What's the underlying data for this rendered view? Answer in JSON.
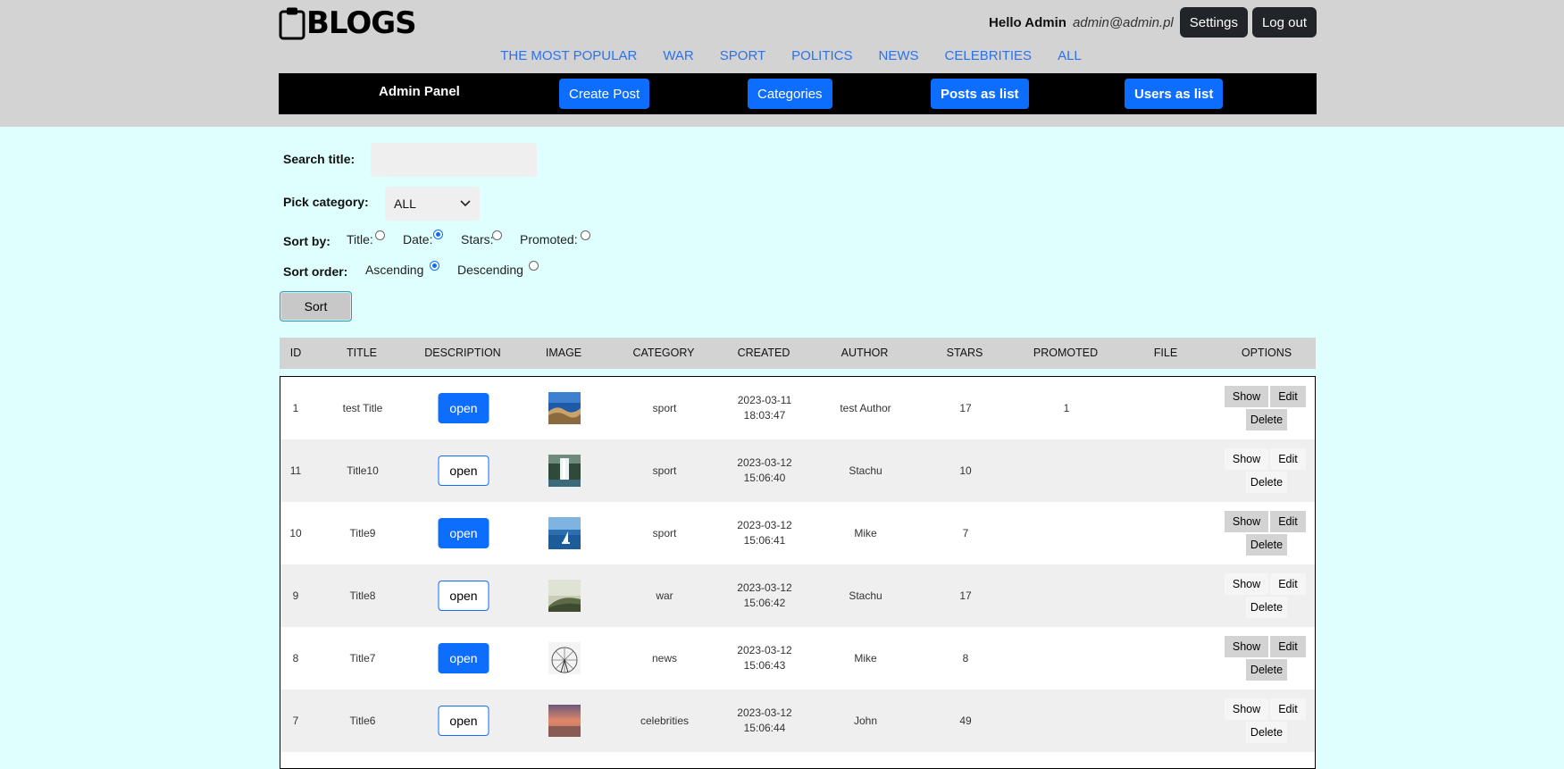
{
  "header": {
    "logo_text": "BLOGS",
    "hello": "Hello Admin",
    "email": "admin@admin.pl",
    "settings_label": "Settings",
    "logout_label": "Log out"
  },
  "nav": {
    "items": [
      "THE MOST POPULAR",
      "WAR",
      "SPORT",
      "POLITICS",
      "NEWS",
      "CELEBRITIES",
      "ALL"
    ]
  },
  "admin_bar": {
    "title": "Admin Panel",
    "create_post": "Create Post",
    "categories": "Categories",
    "posts_list": "Posts as list",
    "users_list": "Users as list"
  },
  "filters": {
    "search_label": "Search title:",
    "search_value": "",
    "category_label": "Pick category:",
    "category_value": "ALL",
    "sort_by_label": "Sort by:",
    "sort_by_options": [
      {
        "label": "Title:",
        "checked": false
      },
      {
        "label": "Date:",
        "checked": true
      },
      {
        "label": "Stars:",
        "checked": false
      },
      {
        "label": "Promoted:",
        "checked": false
      }
    ],
    "sort_order_label": "Sort order:",
    "sort_order_options": [
      {
        "label": "Ascending",
        "checked": true
      },
      {
        "label": "Descending",
        "checked": false
      }
    ],
    "sort_button": "Sort"
  },
  "table": {
    "columns": [
      "ID",
      "TITLE",
      "DESCRIPTION",
      "IMAGE",
      "CATEGORY",
      "CREATED",
      "AUTHOR",
      "STARS",
      "PROMOTED",
      "FILE",
      "OPTIONS"
    ],
    "open_label": "open",
    "show_label": "Show",
    "edit_label": "Edit",
    "delete_label": "Delete",
    "rows": [
      {
        "id": "1",
        "title": "test Title",
        "category": "sport",
        "created_date": "2023-03-11",
        "created_time": "18:03:47",
        "author": "test Author",
        "stars": "17",
        "promoted": "1",
        "file": "",
        "thumb": "ocean-icon"
      },
      {
        "id": "11",
        "title": "Title10",
        "category": "sport",
        "created_date": "2023-03-12",
        "created_time": "15:06:40",
        "author": "Stachu",
        "stars": "10",
        "promoted": "",
        "file": "",
        "thumb": "waterfall-icon"
      },
      {
        "id": "10",
        "title": "Title9",
        "category": "sport",
        "created_date": "2023-03-12",
        "created_time": "15:06:41",
        "author": "Mike",
        "stars": "7",
        "promoted": "",
        "file": "",
        "thumb": "sailboat-icon"
      },
      {
        "id": "9",
        "title": "Title8",
        "category": "war",
        "created_date": "2023-03-12",
        "created_time": "15:06:42",
        "author": "Stachu",
        "stars": "17",
        "promoted": "",
        "file": "",
        "thumb": "hill-icon"
      },
      {
        "id": "8",
        "title": "Title7",
        "category": "news",
        "created_date": "2023-03-12",
        "created_time": "15:06:43",
        "author": "Mike",
        "stars": "8",
        "promoted": "",
        "file": "",
        "thumb": "ferris-wheel-icon"
      },
      {
        "id": "7",
        "title": "Title6",
        "category": "celebrities",
        "created_date": "2023-03-12",
        "created_time": "15:06:44",
        "author": "John",
        "stars": "49",
        "promoted": "",
        "file": "",
        "thumb": "sunset-icon"
      }
    ]
  },
  "colors": {
    "page_bg": "#dfffff",
    "header_bg": "#d3d3d3",
    "primary": "#0d6efd",
    "dark_btn": "#212529",
    "nav_link": "#2b72f0"
  }
}
